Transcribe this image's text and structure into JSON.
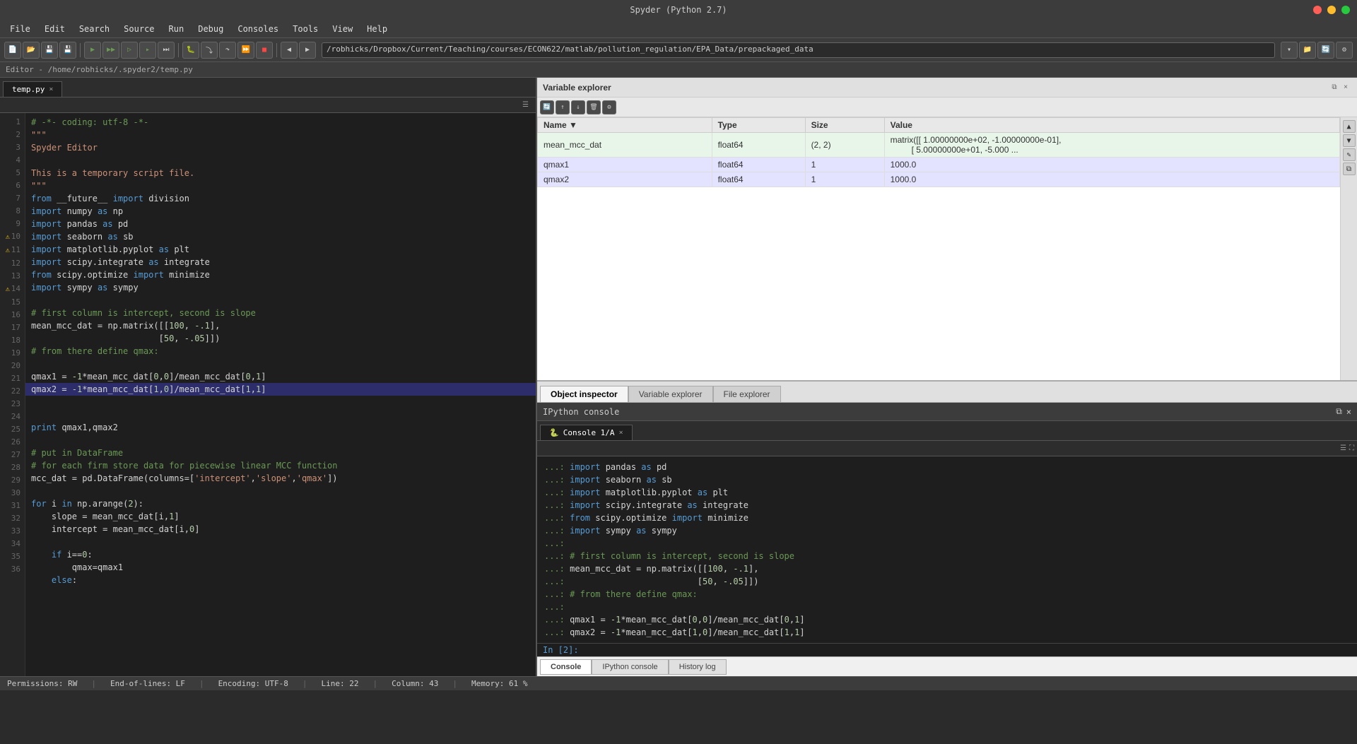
{
  "window": {
    "title": "Spyder (Python 2.7)",
    "controls": [
      "close",
      "min",
      "max"
    ]
  },
  "menu": {
    "items": [
      "File",
      "Edit",
      "Search",
      "Source",
      "Run",
      "Debug",
      "Consoles",
      "Tools",
      "View",
      "Help"
    ]
  },
  "toolbar": {
    "path": "/robhicks/Dropbox/Current/Teaching/courses/ECON622/matlab/pollution_regulation/EPA_Data/prepackaged_data"
  },
  "editor": {
    "header": "Editor - /home/robhicks/.spyder2/temp.py",
    "active_tab": "temp.py",
    "lines": [
      {
        "num": 1,
        "text": "# -*- coding: utf-8 -*-",
        "type": "comment"
      },
      {
        "num": 2,
        "text": "\"\"\"",
        "type": "string"
      },
      {
        "num": 3,
        "text": "Spyder Editor",
        "type": "string"
      },
      {
        "num": 4,
        "text": "",
        "type": "normal"
      },
      {
        "num": 5,
        "text": "This is a temporary script file.",
        "type": "string"
      },
      {
        "num": 6,
        "text": "\"\"\"",
        "type": "string"
      },
      {
        "num": 7,
        "text": "from __future__ import division",
        "type": "normal"
      },
      {
        "num": 8,
        "text": "import numpy as np",
        "type": "normal"
      },
      {
        "num": 9,
        "text": "import pandas as pd",
        "type": "normal"
      },
      {
        "num": 10,
        "text": "import seaborn as sb",
        "type": "normal",
        "warning": true
      },
      {
        "num": 11,
        "text": "import matplotlib.pyplot as plt",
        "type": "normal",
        "warning": true
      },
      {
        "num": 12,
        "text": "import scipy.integrate as integrate",
        "type": "normal"
      },
      {
        "num": 13,
        "text": "from scipy.optimize import minimize",
        "type": "normal"
      },
      {
        "num": 14,
        "text": "import sympy as sympy",
        "type": "normal",
        "warning": true
      },
      {
        "num": 15,
        "text": "",
        "type": "normal"
      },
      {
        "num": 16,
        "text": "# first column is intercept, second is slope",
        "type": "comment"
      },
      {
        "num": 17,
        "text": "mean_mcc_dat = np.matrix([[100, -.1],",
        "type": "normal"
      },
      {
        "num": 18,
        "text": "                         [50, -.05]])",
        "type": "normal"
      },
      {
        "num": 19,
        "text": "# from there define qmax:",
        "type": "comment"
      },
      {
        "num": 20,
        "text": "",
        "type": "normal"
      },
      {
        "num": 21,
        "text": "qmax1 = -1*mean_mcc_dat[0,0]/mean_mcc_dat[0,1]",
        "type": "normal"
      },
      {
        "num": 22,
        "text": "qmax2 = -1*mean_mcc_dat[1,0]/mean_mcc_dat[1,1]",
        "type": "normal",
        "highlight": true
      },
      {
        "num": 23,
        "text": "",
        "type": "normal"
      },
      {
        "num": 24,
        "text": "print qmax1,qmax2",
        "type": "normal"
      },
      {
        "num": 25,
        "text": "",
        "type": "normal"
      },
      {
        "num": 26,
        "text": "# put in DataFrame",
        "type": "comment"
      },
      {
        "num": 27,
        "text": "# for each firm store data for piecewise linear MCC function",
        "type": "comment"
      },
      {
        "num": 28,
        "text": "mcc_dat = pd.DataFrame(columns=['intercept','slope','qmax'])",
        "type": "normal"
      },
      {
        "num": 29,
        "text": "",
        "type": "normal"
      },
      {
        "num": 30,
        "text": "for i in np.arange(2):",
        "type": "normal"
      },
      {
        "num": 31,
        "text": "    slope = mean_mcc_dat[i,1]",
        "type": "normal"
      },
      {
        "num": 32,
        "text": "    intercept = mean_mcc_dat[i,0]",
        "type": "normal"
      },
      {
        "num": 33,
        "text": "",
        "type": "normal"
      },
      {
        "num": 34,
        "text": "    if i==0:",
        "type": "normal"
      },
      {
        "num": 35,
        "text": "        qmax=qmax1",
        "type": "normal"
      },
      {
        "num": 36,
        "text": "    else:",
        "type": "normal"
      }
    ]
  },
  "variable_explorer": {
    "title": "Variable explorer",
    "columns": [
      "Name",
      "▼",
      "Type",
      "Size",
      "Value"
    ],
    "rows": [
      {
        "name": "mean_mcc_dat",
        "type": "float64",
        "size": "(2, 2)",
        "value": "matrix([[ 1.00000000e+02, -1.00000000e-01],\n         [  5.00000000e+01, -5.000 ..."
      },
      {
        "name": "qmax1",
        "type": "float64",
        "size": "1",
        "value": "1000.0"
      },
      {
        "name": "qmax2",
        "type": "float64",
        "size": "1",
        "value": "1000.0"
      }
    ]
  },
  "inspector": {
    "tabs": [
      "Object inspector",
      "Variable explorer",
      "File explorer"
    ]
  },
  "ipython_console": {
    "header": "IPython console",
    "tabs": [
      "Console 1/A"
    ],
    "output_lines": [
      "...: import pandas as pd",
      "...: import seaborn as sb",
      "...: import matplotlib.pyplot as plt",
      "...: import scipy.integrate as integrate",
      "...: from scipy.optimize import minimize",
      "...: import sympy as sympy",
      "...:",
      "...: # first column is intercept, second is slope",
      "...: mean_mcc_dat = np.matrix([[100, -.1],",
      "...:                          [50, -.05]])",
      "...: # from there define qmax:",
      "...:",
      "...: qmax1 = -1*mean_mcc_dat[0,0]/mean_mcc_dat[0,1]",
      "...: qmax2 = -1*mean_mcc_dat[1,0]/mean_mcc_dat[1,1]"
    ],
    "prompt": "In [2]:",
    "bottom_tabs": [
      "Console",
      "IPython console",
      "History log"
    ]
  },
  "status_bar": {
    "permissions": "Permissions: RW",
    "line_endings": "End-of-lines: LF",
    "encoding": "Encoding: UTF-8",
    "line": "Line: 22",
    "column": "Column: 43",
    "memory": "Memory: 61 %"
  }
}
